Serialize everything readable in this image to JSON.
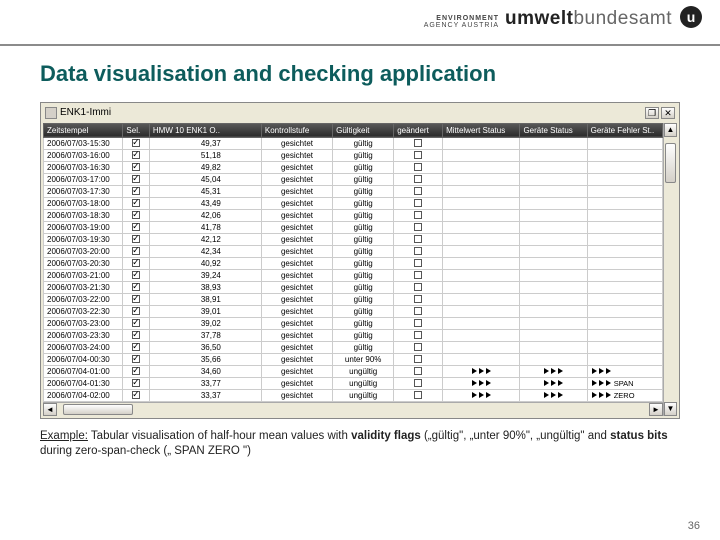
{
  "logo": {
    "env_line1": "ENVIRONMENT",
    "env_line2": "AGENCY AUSTRIA",
    "umwelt_bold": "umwelt",
    "umwelt_rest": "bundesamt",
    "u_mark": "u"
  },
  "heading": "Data visualisation and checking application",
  "app": {
    "window_title": "ENK1-Immi",
    "win_buttons": {
      "max": "❐",
      "close": "✕"
    },
    "columns": [
      "Zeitstempel",
      "Sel.",
      "HMW 10 ENK1 O..",
      "Kontrollstufe",
      "Gültigkeit",
      "geändert",
      "Mittelwert Status",
      "Geräte Status",
      "Geräte Fehler St.."
    ],
    "rows": [
      {
        "ts": "2006/07/03-15:30",
        "sel": true,
        "hmw": "49,37",
        "kon": "gesichtet",
        "gue": "gültig",
        "gea": false,
        "mit": "",
        "ger": "",
        "gef": ""
      },
      {
        "ts": "2006/07/03-16:00",
        "sel": true,
        "hmw": "51,18",
        "kon": "gesichtet",
        "gue": "gültig",
        "gea": false,
        "mit": "",
        "ger": "",
        "gef": ""
      },
      {
        "ts": "2006/07/03-16:30",
        "sel": true,
        "hmw": "49,82",
        "kon": "gesichtet",
        "gue": "gültig",
        "gea": false,
        "mit": "",
        "ger": "",
        "gef": ""
      },
      {
        "ts": "2006/07/03-17:00",
        "sel": true,
        "hmw": "45,04",
        "kon": "gesichtet",
        "gue": "gültig",
        "gea": false,
        "mit": "",
        "ger": "",
        "gef": ""
      },
      {
        "ts": "2006/07/03-17:30",
        "sel": true,
        "hmw": "45,31",
        "kon": "gesichtet",
        "gue": "gültig",
        "gea": false,
        "mit": "",
        "ger": "",
        "gef": ""
      },
      {
        "ts": "2006/07/03-18:00",
        "sel": true,
        "hmw": "43,49",
        "kon": "gesichtet",
        "gue": "gültig",
        "gea": false,
        "mit": "",
        "ger": "",
        "gef": ""
      },
      {
        "ts": "2006/07/03-18:30",
        "sel": true,
        "hmw": "42,06",
        "kon": "gesichtet",
        "gue": "gültig",
        "gea": false,
        "mit": "",
        "ger": "",
        "gef": ""
      },
      {
        "ts": "2006/07/03-19:00",
        "sel": true,
        "hmw": "41,78",
        "kon": "gesichtet",
        "gue": "gültig",
        "gea": false,
        "mit": "",
        "ger": "",
        "gef": ""
      },
      {
        "ts": "2006/07/03-19:30",
        "sel": true,
        "hmw": "42,12",
        "kon": "gesichtet",
        "gue": "gültig",
        "gea": false,
        "mit": "",
        "ger": "",
        "gef": ""
      },
      {
        "ts": "2006/07/03-20:00",
        "sel": true,
        "hmw": "42,34",
        "kon": "gesichtet",
        "gue": "gültig",
        "gea": false,
        "mit": "",
        "ger": "",
        "gef": ""
      },
      {
        "ts": "2006/07/03-20:30",
        "sel": true,
        "hmw": "40,92",
        "kon": "gesichtet",
        "gue": "gültig",
        "gea": false,
        "mit": "",
        "ger": "",
        "gef": ""
      },
      {
        "ts": "2006/07/03-21:00",
        "sel": true,
        "hmw": "39,24",
        "kon": "gesichtet",
        "gue": "gültig",
        "gea": false,
        "mit": "",
        "ger": "",
        "gef": ""
      },
      {
        "ts": "2006/07/03-21:30",
        "sel": true,
        "hmw": "38,93",
        "kon": "gesichtet",
        "gue": "gültig",
        "gea": false,
        "mit": "",
        "ger": "",
        "gef": ""
      },
      {
        "ts": "2006/07/03-22:00",
        "sel": true,
        "hmw": "38,91",
        "kon": "gesichtet",
        "gue": "gültig",
        "gea": false,
        "mit": "",
        "ger": "",
        "gef": ""
      },
      {
        "ts": "2006/07/03-22:30",
        "sel": true,
        "hmw": "39,01",
        "kon": "gesichtet",
        "gue": "gültig",
        "gea": false,
        "mit": "",
        "ger": "",
        "gef": ""
      },
      {
        "ts": "2006/07/03-23:00",
        "sel": true,
        "hmw": "39,02",
        "kon": "gesichtet",
        "gue": "gültig",
        "gea": false,
        "mit": "",
        "ger": "",
        "gef": ""
      },
      {
        "ts": "2006/07/03-23:30",
        "sel": true,
        "hmw": "37,78",
        "kon": "gesichtet",
        "gue": "gültig",
        "gea": false,
        "mit": "",
        "ger": "",
        "gef": ""
      },
      {
        "ts": "2006/07/03-24:00",
        "sel": true,
        "hmw": "36,50",
        "kon": "gesichtet",
        "gue": "gültig",
        "gea": false,
        "mit": "",
        "ger": "",
        "gef": ""
      },
      {
        "ts": "2006/07/04-00:30",
        "sel": true,
        "hmw": "35,66",
        "kon": "gesichtet",
        "gue": "unter 90%",
        "gea": false,
        "mit": "",
        "ger": "",
        "gef": ""
      },
      {
        "ts": "2006/07/04-01:00",
        "sel": true,
        "hmw": "34,60",
        "kon": "gesichtet",
        "gue": "ungültig",
        "gea": false,
        "mit": "arrows",
        "ger": "arrows",
        "gef": "arrows"
      },
      {
        "ts": "2006/07/04-01:30",
        "sel": true,
        "hmw": "33,77",
        "kon": "gesichtet",
        "gue": "ungültig",
        "gea": false,
        "mit": "arrows",
        "ger": "arrows",
        "gef": "SPAN"
      },
      {
        "ts": "2006/07/04-02:00",
        "sel": true,
        "hmw": "33,37",
        "kon": "gesichtet",
        "gue": "ungültig",
        "gea": false,
        "mit": "arrows",
        "ger": "arrows",
        "gef": "ZERO"
      }
    ]
  },
  "caption": {
    "pre": "Example:",
    "text1": " Tabular visualisation of half-hour mean values with ",
    "b1": "validity flags",
    "text2": " („gültig\", „unter 90%\", „ungültig\" and ",
    "b2": "status bits",
    "text3": " during zero-span-check („ SPAN ZERO \")"
  },
  "page_number": "36"
}
